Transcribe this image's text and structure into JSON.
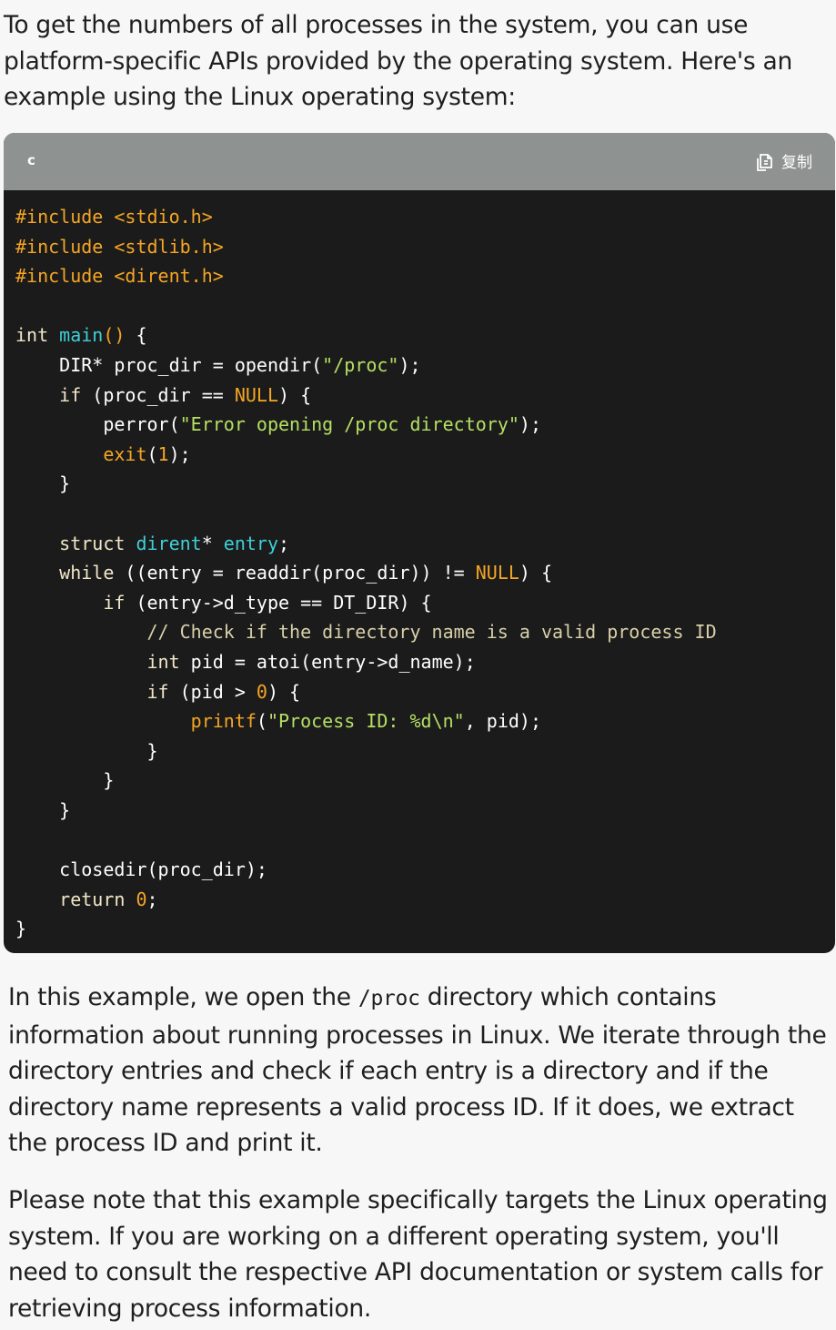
{
  "intro": "To get the numbers of all processes in the system, you can use platform-specific APIs provided by the operating system. Here's an example using the Linux operating system:",
  "code_block": {
    "language": "c",
    "copy_label": "复制",
    "copy_icon": "copy-icon",
    "colors": {
      "background": "#1b1b1b",
      "header": "#8e9392",
      "preprocessor": "#f5a623",
      "keyword": "#f2e6c8",
      "function": "#3ed0d8",
      "string": "#b5e063",
      "comment": "#d8d0a8"
    },
    "lines": [
      [
        [
          "meta",
          "#include <stdio.h>"
        ]
      ],
      [
        [
          "meta",
          "#include <stdlib.h>"
        ]
      ],
      [
        [
          "meta",
          "#include <dirent.h>"
        ]
      ],
      [],
      [
        [
          "kw",
          "int "
        ],
        [
          "fn",
          "main"
        ],
        [
          "lit",
          "()"
        ],
        [
          "plain",
          " {"
        ]
      ],
      [
        [
          "plain",
          "    DIR* proc_dir = opendir("
        ],
        [
          "str",
          "\"/proc\""
        ],
        [
          "plain",
          ");"
        ]
      ],
      [
        [
          "kw",
          "    if"
        ],
        [
          "plain",
          " (proc_dir == "
        ],
        [
          "lit",
          "NULL"
        ],
        [
          "plain",
          ") {"
        ]
      ],
      [
        [
          "plain",
          "        perror("
        ],
        [
          "str",
          "\"Error opening /proc directory\""
        ],
        [
          "plain",
          ");"
        ]
      ],
      [
        [
          "lit",
          "        exit"
        ],
        [
          "plain",
          "("
        ],
        [
          "num",
          "1"
        ],
        [
          "plain",
          ");"
        ]
      ],
      [
        [
          "plain",
          "    }"
        ]
      ],
      [],
      [
        [
          "kw",
          "    struct "
        ],
        [
          "fn",
          "dirent"
        ],
        [
          "plain",
          "* "
        ],
        [
          "fn",
          "entry"
        ],
        [
          "plain",
          ";"
        ]
      ],
      [
        [
          "kw",
          "    while"
        ],
        [
          "plain",
          " ((entry = readdir(proc_dir)) != "
        ],
        [
          "lit",
          "NULL"
        ],
        [
          "plain",
          ") {"
        ]
      ],
      [
        [
          "kw",
          "        if"
        ],
        [
          "plain",
          " (entry->d_type == DT_DIR) {"
        ]
      ],
      [
        [
          "cmt",
          "            // Check if the directory name is a valid process ID"
        ]
      ],
      [
        [
          "kw",
          "            int"
        ],
        [
          "plain",
          " pid = atoi(entry->d_name);"
        ]
      ],
      [
        [
          "kw",
          "            if"
        ],
        [
          "plain",
          " (pid > "
        ],
        [
          "num",
          "0"
        ],
        [
          "plain",
          ") {"
        ]
      ],
      [
        [
          "lit",
          "                printf"
        ],
        [
          "plain",
          "("
        ],
        [
          "str",
          "\"Process ID: %d\\n\""
        ],
        [
          "plain",
          ", pid);"
        ]
      ],
      [
        [
          "plain",
          "            }"
        ]
      ],
      [
        [
          "plain",
          "        }"
        ]
      ],
      [
        [
          "plain",
          "    }"
        ]
      ],
      [],
      [
        [
          "plain",
          "    closedir(proc_dir);"
        ]
      ],
      [
        [
          "kw",
          "    return "
        ],
        [
          "num",
          "0"
        ],
        [
          "plain",
          ";"
        ]
      ],
      [
        [
          "plain",
          "}"
        ]
      ]
    ]
  },
  "explanation": {
    "before": "In this example, we open the ",
    "code": "/proc",
    "after": " directory which contains information about running processes in Linux. We iterate through the directory entries and check if each entry is a directory and if the directory name represents a valid process ID. If it does, we extract the process ID and print it."
  },
  "note": "Please note that this example specifically targets the Linux operating system. If you are working on a different operating system, you'll need to consult the respective API documentation or system calls for retrieving process information."
}
